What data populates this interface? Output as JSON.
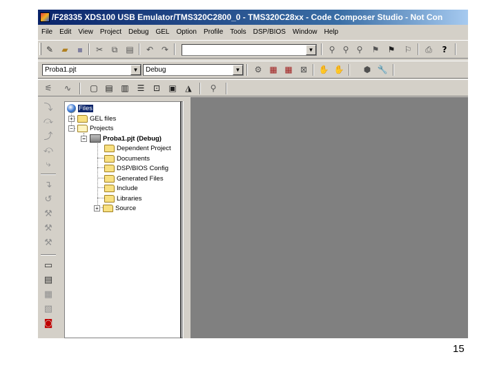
{
  "window": {
    "title": "/F28335 XDS100 USB Emulator/TMS320C2800_0 - TMS320C28xx - Code Composer Studio - Not Con"
  },
  "menu": [
    "File",
    "Edit",
    "View",
    "Project",
    "Debug",
    "GEL",
    "Option",
    "Profile",
    "Tools",
    "DSP/BIOS",
    "Window",
    "Help"
  ],
  "toolbar": {
    "find_combo_value": "",
    "project_combo_value": "Proba1.pjt",
    "config_combo_value": "Debug"
  },
  "project_tree": {
    "root": "Files",
    "items": [
      {
        "label": "GEL files"
      },
      {
        "label": "Projects"
      },
      {
        "label": "Proba1.pjt (Debug)"
      },
      {
        "label": "Dependent Project"
      },
      {
        "label": "Documents"
      },
      {
        "label": "DSP/BIOS Config"
      },
      {
        "label": "Generated Files"
      },
      {
        "label": "Include"
      },
      {
        "label": "Libraries"
      },
      {
        "label": "Source"
      }
    ]
  },
  "icons": {
    "toolbar1": [
      "new-icon",
      "open-icon",
      "save-icon",
      "cut-icon",
      "copy-icon",
      "paste-icon",
      "undo-icon",
      "redo-icon",
      "find-next-icon",
      "find-prev-icon",
      "find-in-files-icon",
      "bookmark-icon",
      "bookmark-next-icon",
      "print-icon",
      "help-icon"
    ],
    "toolbar2": [
      "compile-icon",
      "build-icon",
      "rebuild-icon",
      "stop-build-icon",
      "breakpoint-icon",
      "probe-point-icon",
      "clear-icon",
      "options-icon"
    ],
    "toolbar3": [
      "watch-icon",
      "graph-icon",
      "memory-icon",
      "registers-icon",
      "disassembly-icon",
      "call-stack-icon",
      "image-icon",
      "chart-icon",
      "profile-icon"
    ]
  },
  "slide": {
    "page_number": "15"
  }
}
